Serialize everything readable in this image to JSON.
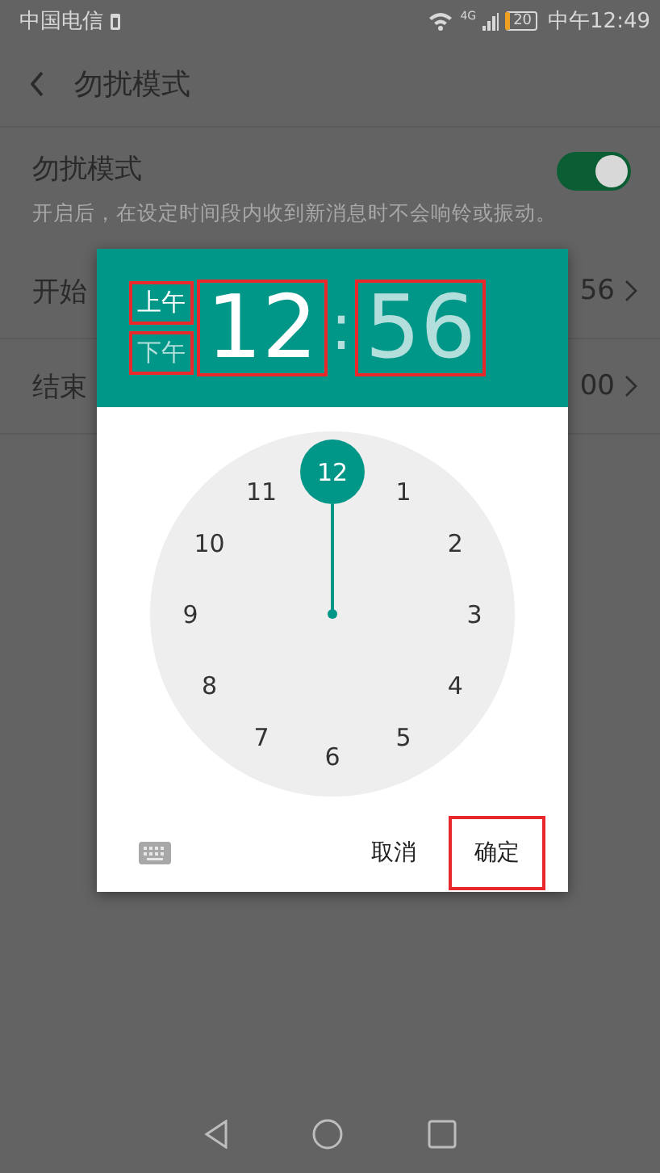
{
  "status_bar": {
    "carrier": "中国电信",
    "network": "4G",
    "battery": "20",
    "time": "中午12:49"
  },
  "header": {
    "title": "勿扰模式"
  },
  "settings": {
    "toggle": {
      "label": "勿扰模式",
      "description": "开启后，在设定时间段内收到新消息时不会响铃或振动。",
      "on": true
    },
    "rows": [
      {
        "label": "开始",
        "value": "56"
      },
      {
        "label": "结束",
        "value": "00"
      }
    ]
  },
  "time_picker": {
    "periods": [
      {
        "label": "上午",
        "selected": true,
        "highlighted": true
      },
      {
        "label": "下午",
        "selected": false,
        "highlighted": true
      }
    ],
    "hour": {
      "text": "12",
      "selected": true,
      "highlighted": true
    },
    "separator": ":",
    "minute": {
      "text": "56",
      "selected": false,
      "highlighted": true
    },
    "dial": [
      {
        "label": "12",
        "selected": true
      },
      {
        "label": "1",
        "selected": false
      },
      {
        "label": "2",
        "selected": false
      },
      {
        "label": "3",
        "selected": false
      },
      {
        "label": "4",
        "selected": false
      },
      {
        "label": "5",
        "selected": false
      },
      {
        "label": "6",
        "selected": false
      },
      {
        "label": "7",
        "selected": false
      },
      {
        "label": "8",
        "selected": false
      },
      {
        "label": "9",
        "selected": false
      },
      {
        "label": "10",
        "selected": false
      },
      {
        "label": "11",
        "selected": false
      }
    ],
    "buttons": [
      {
        "label": "取消",
        "highlighted": false
      },
      {
        "label": "确定",
        "highlighted": true
      }
    ]
  }
}
